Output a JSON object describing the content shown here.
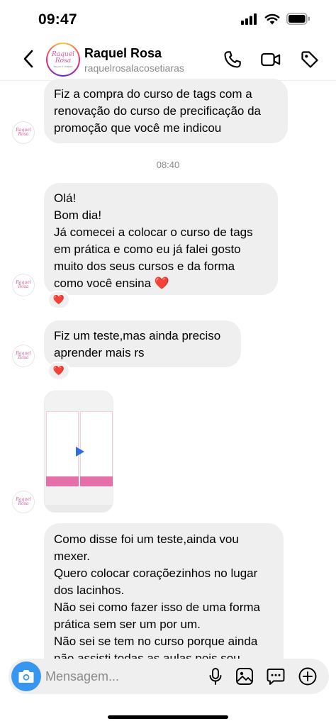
{
  "status_bar": {
    "time": "09:47"
  },
  "header": {
    "contact_name": "Raquel Rosa",
    "contact_handle": "raquelrosalacosetiaras",
    "logo_text": "Raquel Rosa",
    "logo_sub": "laços e tiaras"
  },
  "messages": [
    {
      "lines": [
        "Fiz a compra do curso de tags com a",
        "renovação do curso de precificação da",
        "promoção que você me indicou"
      ]
    },
    {
      "lines": [
        "Olá!",
        "Bom dia!",
        "Já comecei a colocar o curso de tags",
        "em prática e como eu já falei gosto",
        "muito dos seus cursos e da forma",
        "como você ensina ❤️"
      ],
      "reaction": "❤️"
    },
    {
      "lines": [
        "Fiz um teste,mas ainda preciso",
        "aprender mais rs"
      ],
      "reaction": "❤️"
    },
    {
      "lines": [
        "Como disse foi um teste,ainda vou",
        "mexer.",
        "Quero colocar coraçõezinhos no lugar",
        "dos lacinhos.",
        "Não sei como fazer isso de uma forma",
        "prática sem ser um por um.",
        "Não sei se tem no curso porque ainda",
        "não assisti todas as aulas,pois sou"
      ]
    }
  ],
  "timestamp": "08:40",
  "composer": {
    "placeholder": "Mensagem..."
  },
  "colors": {
    "accent": "#3797f0",
    "bubble": "#efefef",
    "heart": "#e0245e",
    "video_pink": "#e56fa8"
  }
}
